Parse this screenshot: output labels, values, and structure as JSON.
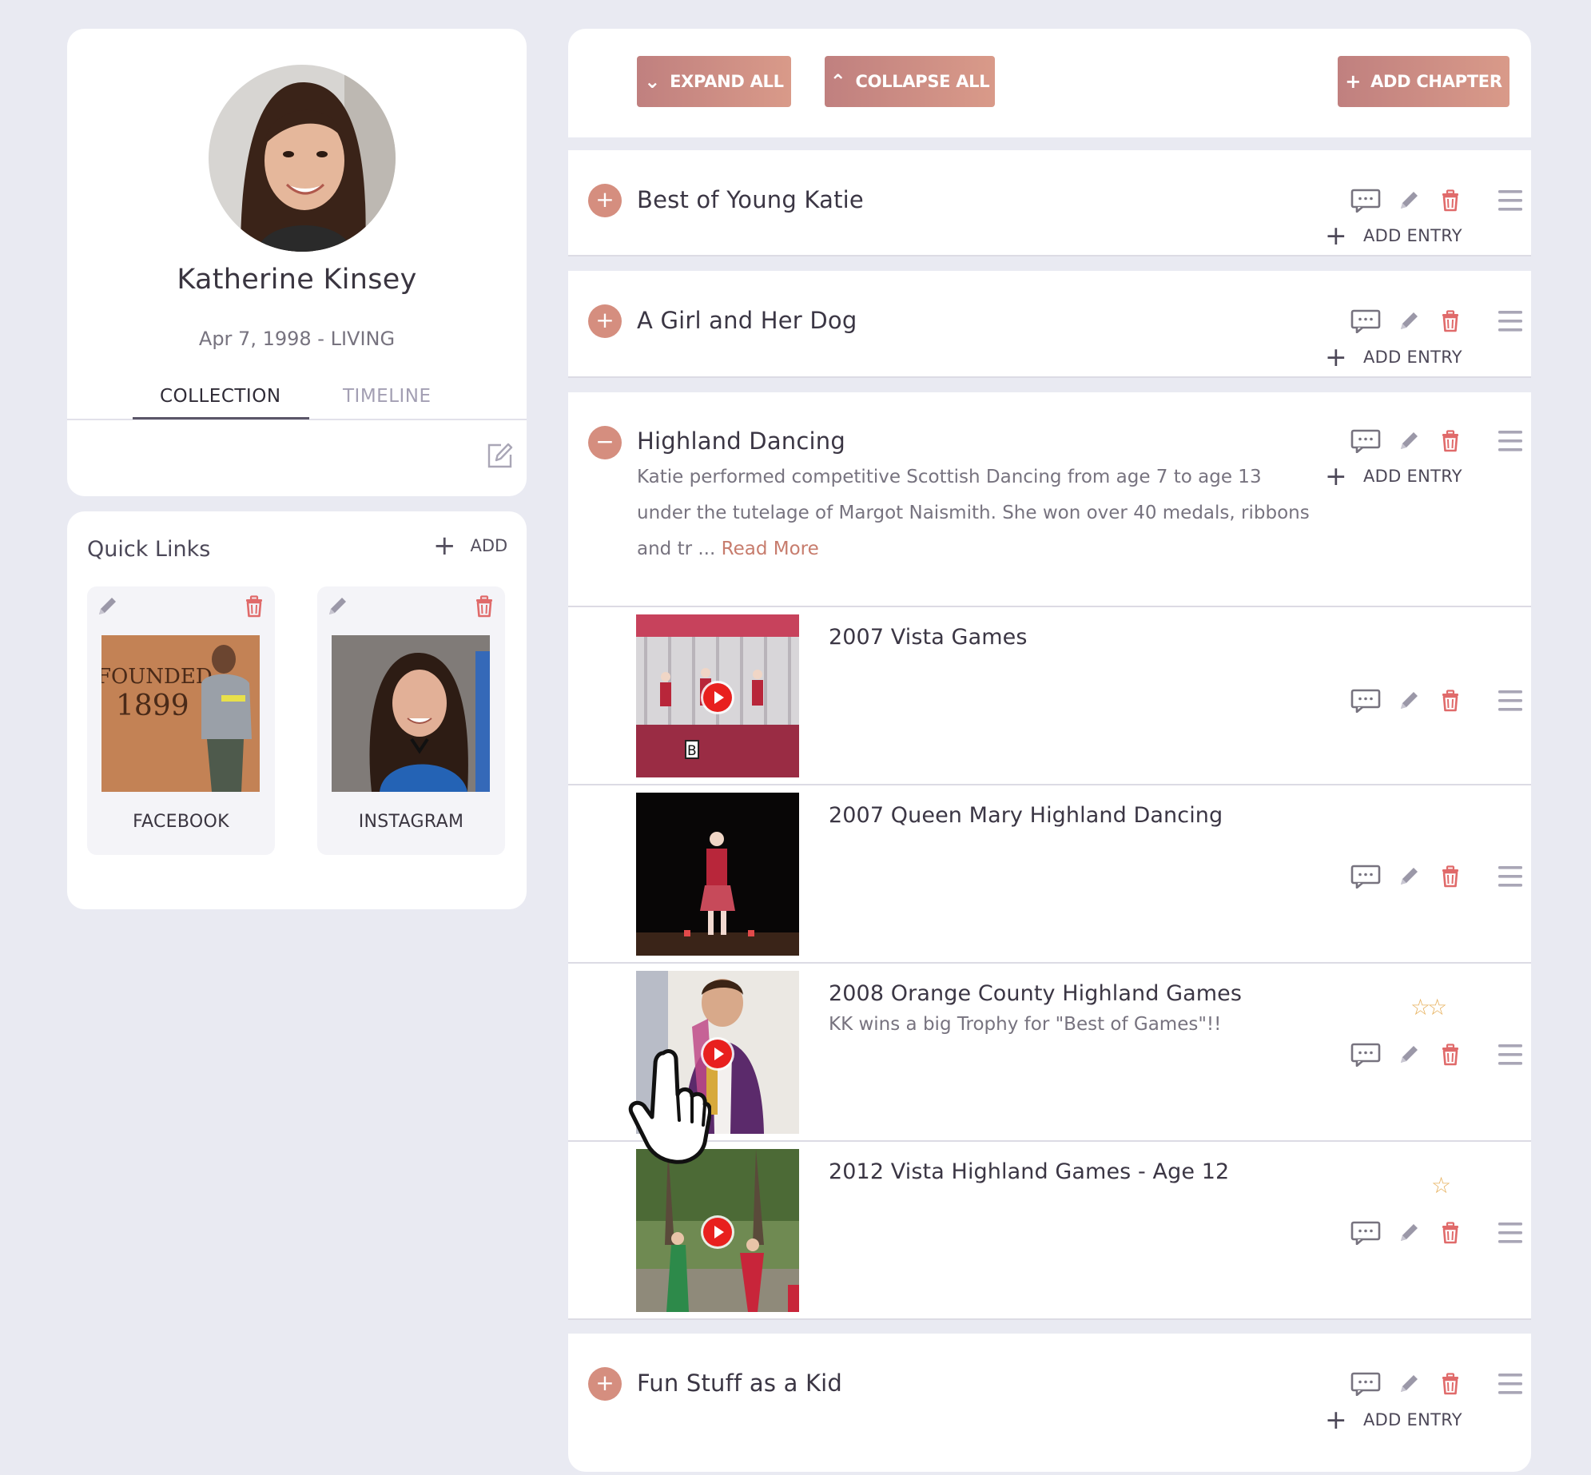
{
  "profile": {
    "name": "Katherine Kinsey",
    "dates": "Apr 7, 1998 - LIVING",
    "tabs": [
      {
        "label": "COLLECTION",
        "active": true
      },
      {
        "label": "TIMELINE",
        "active": false
      }
    ]
  },
  "quick_links": {
    "title": "Quick Links",
    "add_label": "ADD",
    "items": [
      {
        "label": "FACEBOOK",
        "image_text_1": "FOUNDED",
        "image_text_2": "1899"
      },
      {
        "label": "INSTAGRAM"
      }
    ]
  },
  "toolbar": {
    "expand_all": "EXPAND ALL",
    "collapse_all": "COLLAPSE ALL",
    "add_chapter": "ADD CHAPTER"
  },
  "add_entry_label": "ADD ENTRY",
  "chapters": [
    {
      "title": "Best of Young Katie",
      "expanded": false
    },
    {
      "title": "A Girl and Her Dog",
      "expanded": false
    },
    {
      "title": "Highland Dancing",
      "expanded": true,
      "description_line1": "Katie performed competitive Scottish Dancing from age 7 to age 13",
      "description_line2": "under the tutelage of Margot Naismith.  She won over 40 medals, ribbons",
      "description_line3": "and tr ...",
      "read_more": "Read More",
      "entries": [
        {
          "title": "2007 Vista Games",
          "description": "",
          "stars": "",
          "video": true,
          "thumb_letter": "B"
        },
        {
          "title": "2007 Queen Mary Highland Dancing",
          "description": "",
          "stars": "",
          "video": false
        },
        {
          "title": "2008 Orange County Highland Games",
          "description": "KK wins a big Trophy for \"Best of Games\"!!",
          "stars": "☆☆",
          "video": true
        },
        {
          "title": "2012 Vista Highland Games - Age 12",
          "description": "",
          "stars": "☆",
          "video": true
        }
      ]
    },
    {
      "title": "Fun Stuff as a Kid",
      "expanded": false
    }
  ],
  "colors": {
    "accent": "#d58e7f",
    "button_gradient_start": "#c0807f",
    "button_gradient_end": "#d99a89",
    "delete_icon": "#e06a6a",
    "star": "#e7b15e",
    "background": "#e9eaf2"
  },
  "icons": {
    "comment": "comment-icon",
    "edit": "pencil-icon",
    "delete": "trash-icon",
    "drag": "drag-handle-icon",
    "play": "play-icon",
    "cursor": "hand-pointer-icon"
  }
}
